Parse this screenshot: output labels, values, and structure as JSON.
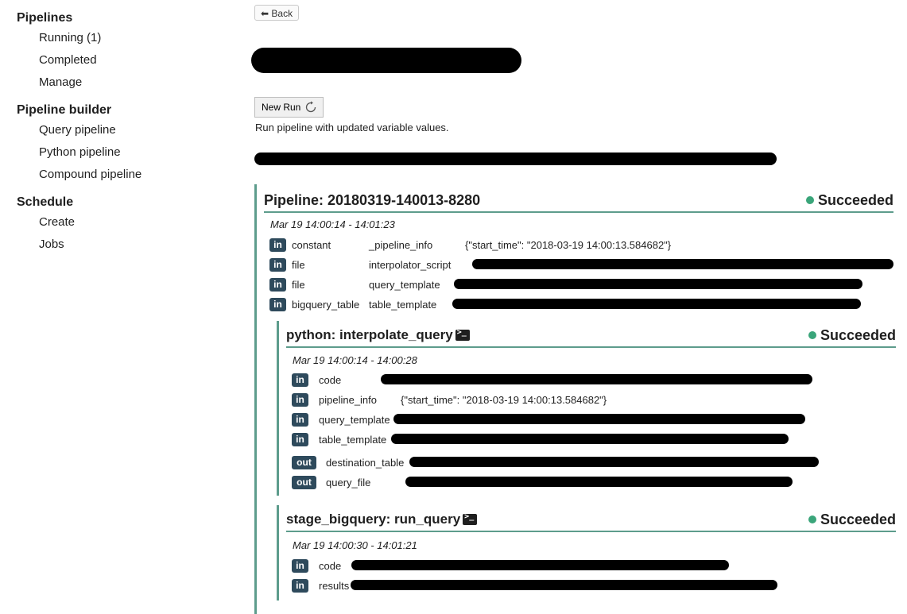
{
  "sidebar": [
    {
      "heading": "Pipelines",
      "items": [
        "Running (1)",
        "Completed",
        "Manage"
      ]
    },
    {
      "heading": "Pipeline builder",
      "items": [
        "Query pipeline",
        "Python pipeline",
        "Compound pipeline"
      ]
    },
    {
      "heading": "Schedule",
      "items": [
        "Create",
        "Jobs"
      ]
    }
  ],
  "toolbar": {
    "back_label": "⬅ Back"
  },
  "run": {
    "new_run_label": "New Run",
    "description": "Run pipeline with updated variable values."
  },
  "pipeline": {
    "title": "Pipeline: 20180319-140013-8280",
    "status": "Succeeded",
    "time": "Mar 19 14:00:14 - 14:01:23",
    "inputs": [
      {
        "dir": "in",
        "type": "constant",
        "name": "_pipeline_info",
        "value": "{\"start_time\": \"2018-03-19 14:00:13.584682\"}"
      },
      {
        "dir": "in",
        "type": "file",
        "name": "interpolator_script",
        "value": ""
      },
      {
        "dir": "in",
        "type": "file",
        "name": "query_template",
        "value": ""
      },
      {
        "dir": "in",
        "type": "bigquery_table",
        "name": "table_template",
        "value": ""
      }
    ]
  },
  "stages": [
    {
      "title": "python: interpolate_query",
      "status": "Succeeded",
      "time": "Mar 19 14:00:14 - 14:00:28",
      "rows": [
        {
          "dir": "in",
          "name": "code",
          "value": ""
        },
        {
          "dir": "in",
          "name": "pipeline_info",
          "value": "{\"start_time\": \"2018-03-19 14:00:13.584682\"}"
        },
        {
          "dir": "in",
          "name": "query_template",
          "value": ""
        },
        {
          "dir": "in",
          "name": "table_template",
          "value": ""
        },
        {
          "dir": "out",
          "name": "destination_table",
          "value": ""
        },
        {
          "dir": "out",
          "name": "query_file",
          "value": ""
        }
      ]
    },
    {
      "title": "stage_bigquery: run_query",
      "status": "Succeeded",
      "time": "Mar 19 14:00:30 - 14:01:21",
      "rows": [
        {
          "dir": "in",
          "name": "code",
          "value": ""
        },
        {
          "dir": "in",
          "name": "results",
          "value": ""
        }
      ]
    }
  ],
  "colors": {
    "accent": "#5d9c8c",
    "badge": "#2e4a5c",
    "success": "#3aa57a"
  }
}
